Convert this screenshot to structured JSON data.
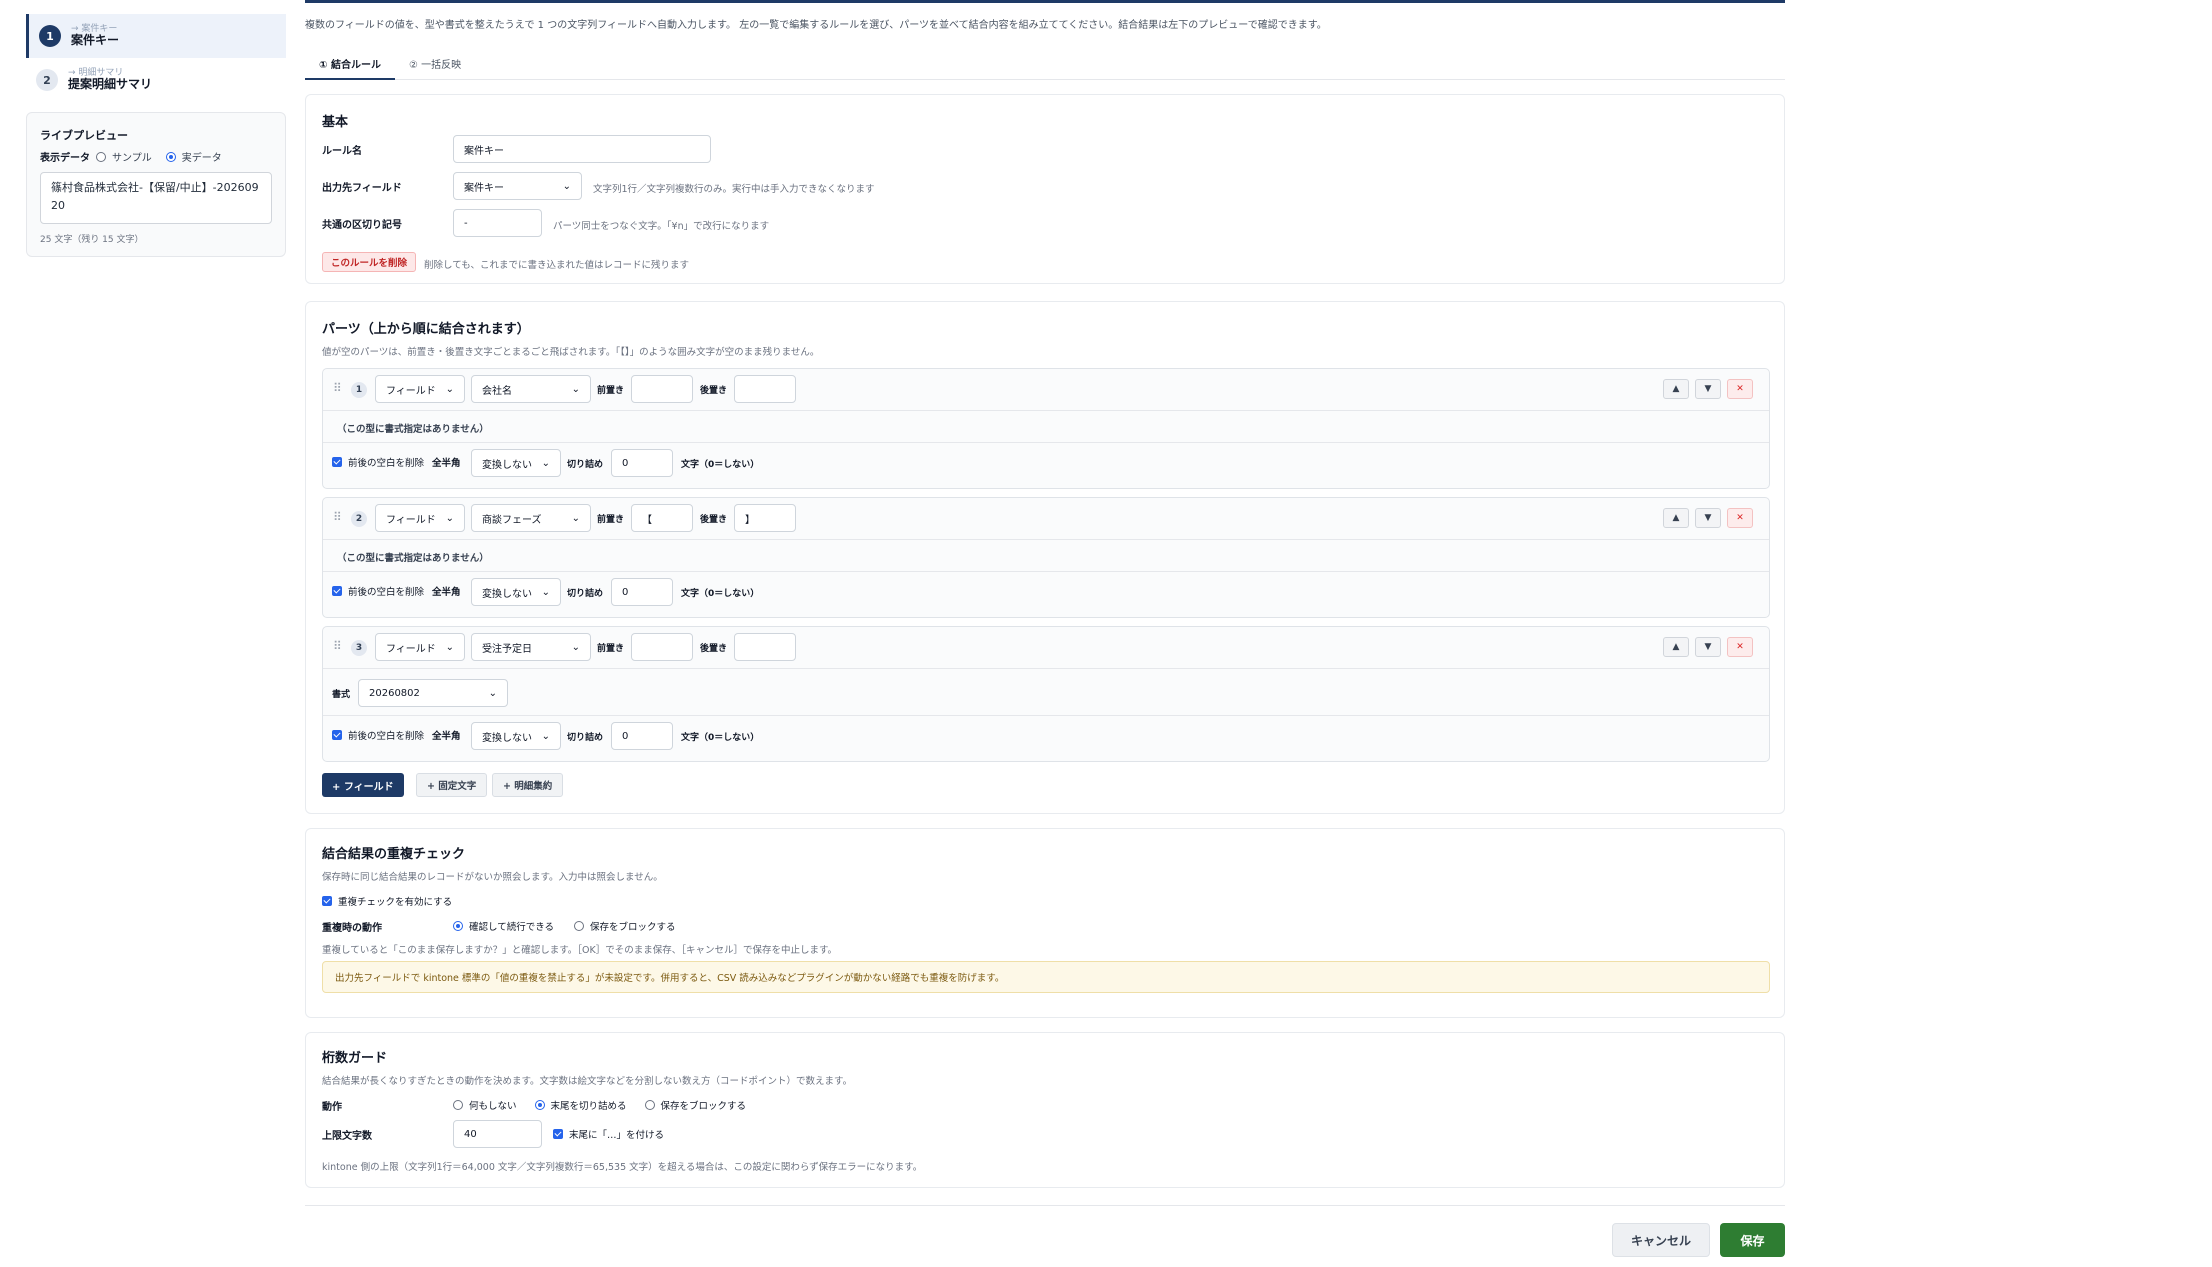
{
  "sidebar": {
    "rules": [
      {
        "num": "1",
        "sub": "→ 案件キー",
        "title": "案件キー"
      },
      {
        "num": "2",
        "sub": "→ 明細サマリ",
        "title": "提案明細サマリ"
      }
    ]
  },
  "preview": {
    "title": "ライブプレビュー",
    "mode_label": "表示データ",
    "mode_sample": "サンプル",
    "mode_real": "実データ",
    "value": "篠村食品株式会社-【保留/中止】-20260920",
    "count": "25 文字（残り 15 文字）"
  },
  "main": {
    "intro": "複数のフィールドの値を、型や書式を整えたうえで 1 つの文字列フィールドへ自動入力します。 左の一覧で編集するルールを選び、パーツを並べて結合内容を組み立ててください。結合結果は左下のプレビューで確認できます。",
    "tabs": [
      "① 結合ルール",
      "② 一括反映"
    ]
  },
  "basic": {
    "title": "基本",
    "rule_name_label": "ルール名",
    "rule_name_value": "案件キー",
    "output_label": "出力先フィールド",
    "output_value": "案件キー",
    "output_hint": "文字列1行／文字列複数行のみ。実行中は手入力できなくなります",
    "sep_label": "共通の区切り記号",
    "sep_value": "-",
    "sep_hint": "パーツ同士をつなぐ文字。「¥n」で改行になります",
    "delete_label": "このルールを削除",
    "delete_hint": "削除しても、これまでに書き込まれた値はレコードに残ります"
  },
  "parts": {
    "title": "パーツ（上から順に結合されます）",
    "subtitle": "値が空のパーツは、前置き・後置き文字ごとまるごと飛ばされます。「【】」のような囲み文字が空のまま残りません。",
    "common": {
      "prefix_label": "前置き",
      "suffix_label": "後置き",
      "trim_label": "前後の空白を削除",
      "width_label": "全半角",
      "width_value": "変換しない",
      "cut_label": "切り詰め",
      "cut_unit": "文字（0＝しない）",
      "no_format": "（この型に書式指定はありません）",
      "format_label": "書式",
      "up": "▲",
      "down": "▼",
      "del": "✕"
    },
    "items": [
      {
        "num": "1",
        "type": "フィールド",
        "field": "会社名",
        "prefix": "",
        "suffix": "",
        "cut": "0"
      },
      {
        "num": "2",
        "type": "フィールド",
        "field": "商談フェーズ",
        "prefix": "【",
        "suffix": "】",
        "cut": "0"
      },
      {
        "num": "3",
        "type": "フィールド",
        "field": "受注予定日",
        "prefix": "",
        "suffix": "",
        "cut": "0",
        "format": "20260802"
      }
    ],
    "add_field": "+ フィールド",
    "add_fixed": "+ 固定文字",
    "add_detail": "+ 明細集約"
  },
  "dup": {
    "title": "結合結果の重複チェック",
    "subtitle": "保存時に同じ結合結果のレコードがないか照会します。入力中は照会しません。",
    "enable_label": "重複チェックを有効にする",
    "action_label": "重複時の動作",
    "opt_confirm": "確認して続行できる",
    "opt_block": "保存をブロックする",
    "hint": "重複していると「このまま保存しますか？」と確認します。［OK］でそのまま保存、［キャンセル］で保存を中止します。",
    "warning": "出力先フィールドで kintone 標準の「値の重複を禁止する」が未設定です。併用すると、CSV 読み込みなどプラグインが動かない経路でも重複を防げます。"
  },
  "guard": {
    "title": "桁数ガード",
    "subtitle": "結合結果が長くなりすぎたときの動作を決めます。文字数は絵文字などを分割しない数え方（コードポイント）で数えます。",
    "action_label": "動作",
    "opt_none": "何もしない",
    "opt_cut": "末尾を切り詰める",
    "opt_block": "保存をブロックする",
    "limit_label": "上限文字数",
    "limit_value": "40",
    "ellipsis_label": "末尾に「…」を付ける",
    "footnote": "kintone 側の上限（文字列1行＝64,000 文字／文字列複数行＝65,535 文字）を超える場合は、この設定に関わらず保存エラーになります。"
  },
  "footer": {
    "cancel": "キャンセル",
    "save": "保存"
  },
  "colors": {
    "primary": "#1e3a66",
    "save": "#2e7d32",
    "danger": "#c02626",
    "accent": "#2563eb"
  }
}
